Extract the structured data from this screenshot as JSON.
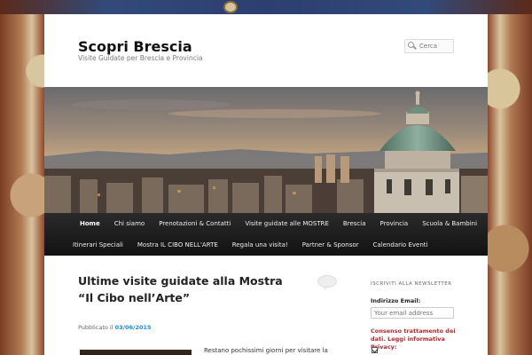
{
  "site": {
    "title": "Scopri Brescia",
    "description": "Visite Guidate per Brescia e Provincia"
  },
  "search": {
    "placeholder": "Cerca"
  },
  "menu": {
    "row1": [
      "Home",
      "Chi siamo",
      "Prenotazioni & Contatti",
      "Visite guidate alle MOSTRE",
      "Brescia",
      "Provincia",
      "Scuola & Bambini"
    ],
    "row2": [
      "Itinerari Speciali",
      "Mostra IL CIBO NELL'ARTE",
      "Regala una visita!",
      "Partner & Sponsor",
      "Calendario Eventi"
    ],
    "active": "Home"
  },
  "post": {
    "title": "Ultime visite guidate alla Mostra “Il Cibo nell’Arte”",
    "meta_prefix": "Pubblicato il",
    "date": "03/06/2015",
    "excerpt": "Restano pochissimi giorni per visitare la"
  },
  "sidebar": {
    "heading": "Iscriviti alla newsletter",
    "email_label": "Indirizzo Email:",
    "email_placeholder": "Your email address",
    "consent": "Consenso trattamento dei dati. Leggi informativa Privacy:",
    "consent_checked": true
  },
  "colors": {
    "menu_bg": "#1b1b1b",
    "date_link": "#1b8be0",
    "consent_red": "#b8282e"
  }
}
